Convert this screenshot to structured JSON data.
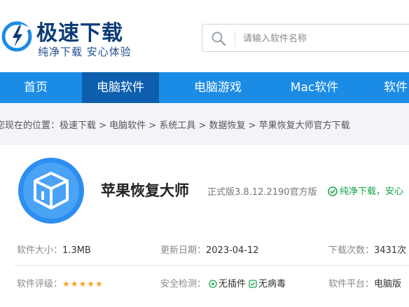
{
  "brand": {
    "title": "极速下载",
    "slogan": "纯净下载 安心体验"
  },
  "search": {
    "placeholder": "请输入软件名称"
  },
  "nav": {
    "items": [
      "首页",
      "电脑软件",
      "电脑游戏",
      "Mac软件",
      "软件"
    ],
    "active_index": 1
  },
  "breadcrumb": {
    "text": "您现在的位置：极速下载 > 电脑软件 > 系统工具 > 数据恢复 > 苹果恢复大师官方下载"
  },
  "app": {
    "name": "苹果恢复大师",
    "version": "正式版3.8.12.2190官方版",
    "safe_tag": "纯净下载，安心"
  },
  "info": {
    "size_label": "软件大小：",
    "size_value": "1.3MB",
    "date_label": "更新日期：",
    "date_value": "2023-04-12",
    "downloads_label": "下载次数：",
    "downloads_value": "3431次",
    "rating_label": "软件评级：",
    "rating_stars": "★★★★★",
    "rating_value": 5,
    "security_label": "安全检测：",
    "security_item1": "无插件",
    "security_item2": "无病毒",
    "platform_label": "软件平台：",
    "platform_value": "电脑版"
  },
  "colors": {
    "nav_bg": "#1b8ce6",
    "nav_active": "#0d5fae",
    "safe_green": "#18a14a",
    "star": "#f5a623"
  },
  "icons": {
    "logo": "download-cloud-logo",
    "search": "search-icon",
    "app": "box-app-icon",
    "check": "check-circle-icon"
  }
}
